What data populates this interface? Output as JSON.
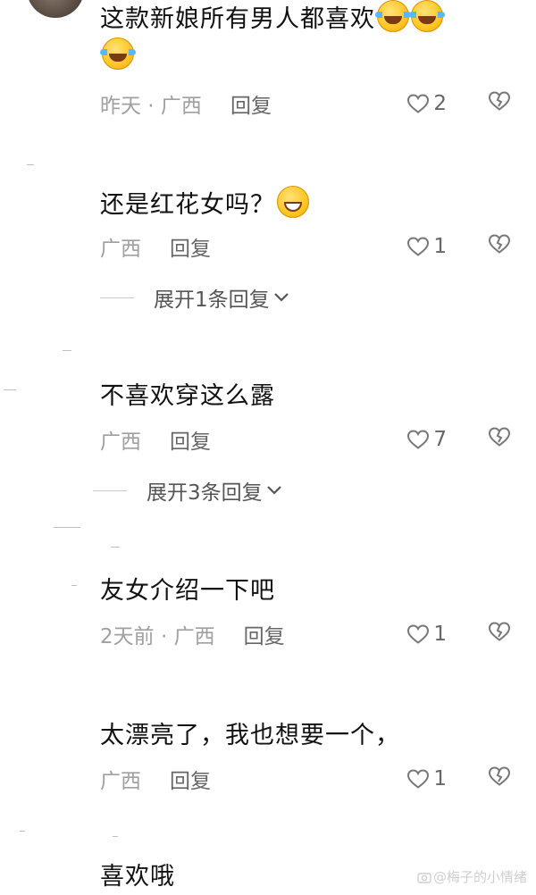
{
  "comments": [
    {
      "text": "这款新娘所有男人都喜欢",
      "emojis": [
        "rolling-laughing-emoji",
        "rolling-laughing-emoji",
        "rolling-laughing-emoji"
      ],
      "meta": "昨天 · 广西",
      "reply": "回复",
      "likes": "2"
    },
    {
      "text": "还是红花女吗？",
      "emojis": [
        "grinning-emoji"
      ],
      "meta": "广西",
      "reply": "回复",
      "likes": "1",
      "expand": "展开1条回复"
    },
    {
      "text": "不喜欢穿这么露",
      "meta": "广西",
      "reply": "回复",
      "likes": "7",
      "expand": "展开3条回复"
    },
    {
      "text": "友女介绍一下吧",
      "meta": "2天前 · 广西",
      "reply": "回复",
      "likes": "1"
    },
    {
      "text": "太漂亮了，我也想要一个，",
      "meta": "广西",
      "reply": "回复",
      "likes": "1"
    },
    {
      "text": "喜欢哦"
    }
  ],
  "watermark": "@梅子的小情绪",
  "colors": {
    "text": "#111111",
    "meta": "#a0a0a0",
    "reply": "#666666",
    "expand": "#555555"
  }
}
